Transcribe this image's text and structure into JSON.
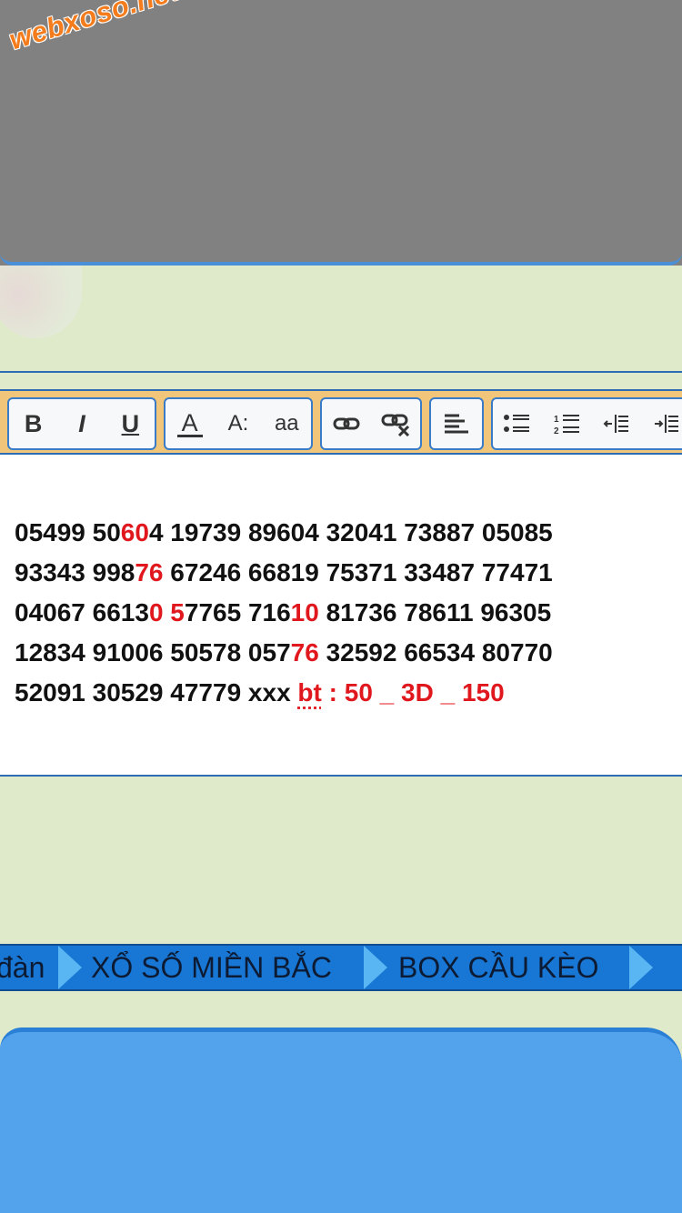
{
  "watermark": "webxoso.net",
  "toolbar": {
    "bold": "B",
    "italic": "I",
    "underline": "U",
    "font_color": "A",
    "font_size": "A:",
    "font_family": "aa"
  },
  "post": {
    "lines": [
      [
        {
          "t": "05499 50"
        },
        {
          "t": "60",
          "hl": true
        },
        {
          "t": "4 19739 89604 32041 73887 05085"
        }
      ],
      [
        {
          "t": "93343 998"
        },
        {
          "t": "76",
          "hl": true
        },
        {
          "t": " 67246 66819 75371 33487 77471"
        }
      ],
      [
        {
          "t": "04067 6613"
        },
        {
          "t": "0",
          "hl": true
        },
        {
          "t": " "
        },
        {
          "t": "5",
          "hl": true
        },
        {
          "t": "7765 716"
        },
        {
          "t": "10",
          "hl": true
        },
        {
          "t": " 81736 78611 96305"
        }
      ],
      [
        {
          "t": "12834 91006 50578 057"
        },
        {
          "t": "76",
          "hl": true
        },
        {
          "t": " 32592 66534 80770"
        }
      ],
      [
        {
          "t": "52091 30529 47779 xxx "
        },
        {
          "t": "bt",
          "bt": true
        },
        {
          "t": " : 50 _ 3D _ 150",
          "hl": true
        }
      ]
    ]
  },
  "nav": {
    "item_partial": "đàn",
    "item_1": "XỔ SỐ MIỀN BẮC",
    "item_2": "BOX CẦU KÈO"
  },
  "colors": {
    "highlight": "#e0181e",
    "accent_blue": "#1877d4",
    "toolbar_bg": "#f2c67a",
    "page_bg": "#dfeacb"
  }
}
